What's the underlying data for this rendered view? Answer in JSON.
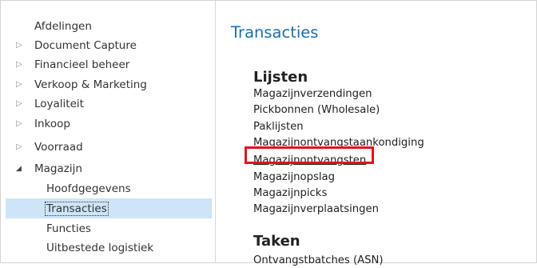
{
  "nav": {
    "header": "Afdelingen",
    "items": [
      {
        "label": "Document Capture"
      },
      {
        "label": "Financieel beheer"
      },
      {
        "label": "Verkoop & Marketing"
      },
      {
        "label": "Loyaliteit"
      },
      {
        "label": "Inkoop"
      },
      {
        "label": "Voorraad"
      },
      {
        "label": "Magazijn"
      }
    ],
    "subitems": [
      {
        "label": "Hoofdgegevens"
      },
      {
        "label": "Transacties"
      },
      {
        "label": "Functies"
      },
      {
        "label": "Uitbestede logistiek"
      }
    ],
    "collapsed_icon": "triangle-right-icon",
    "expanded_icon": "triangle-down-icon"
  },
  "main": {
    "title": "Transacties",
    "sections": [
      {
        "title": "Lijsten",
        "links": [
          "Magazijnverzendingen",
          "Pickbonnen (Wholesale)",
          "Paklijsten",
          "Magazijnontvangstaankondiging",
          "Magazijnontvangsten",
          "Magazijnopslag",
          "Magazijnpicks",
          "Magazijnverplaatsingen"
        ]
      },
      {
        "title": "Taken",
        "links": [
          "Ontvangstbatches (ASN)"
        ]
      }
    ]
  },
  "colors": {
    "title_blue": "#1f6ea8",
    "selection_bg": "#cde5f7",
    "highlight_red": "#e0141e"
  }
}
